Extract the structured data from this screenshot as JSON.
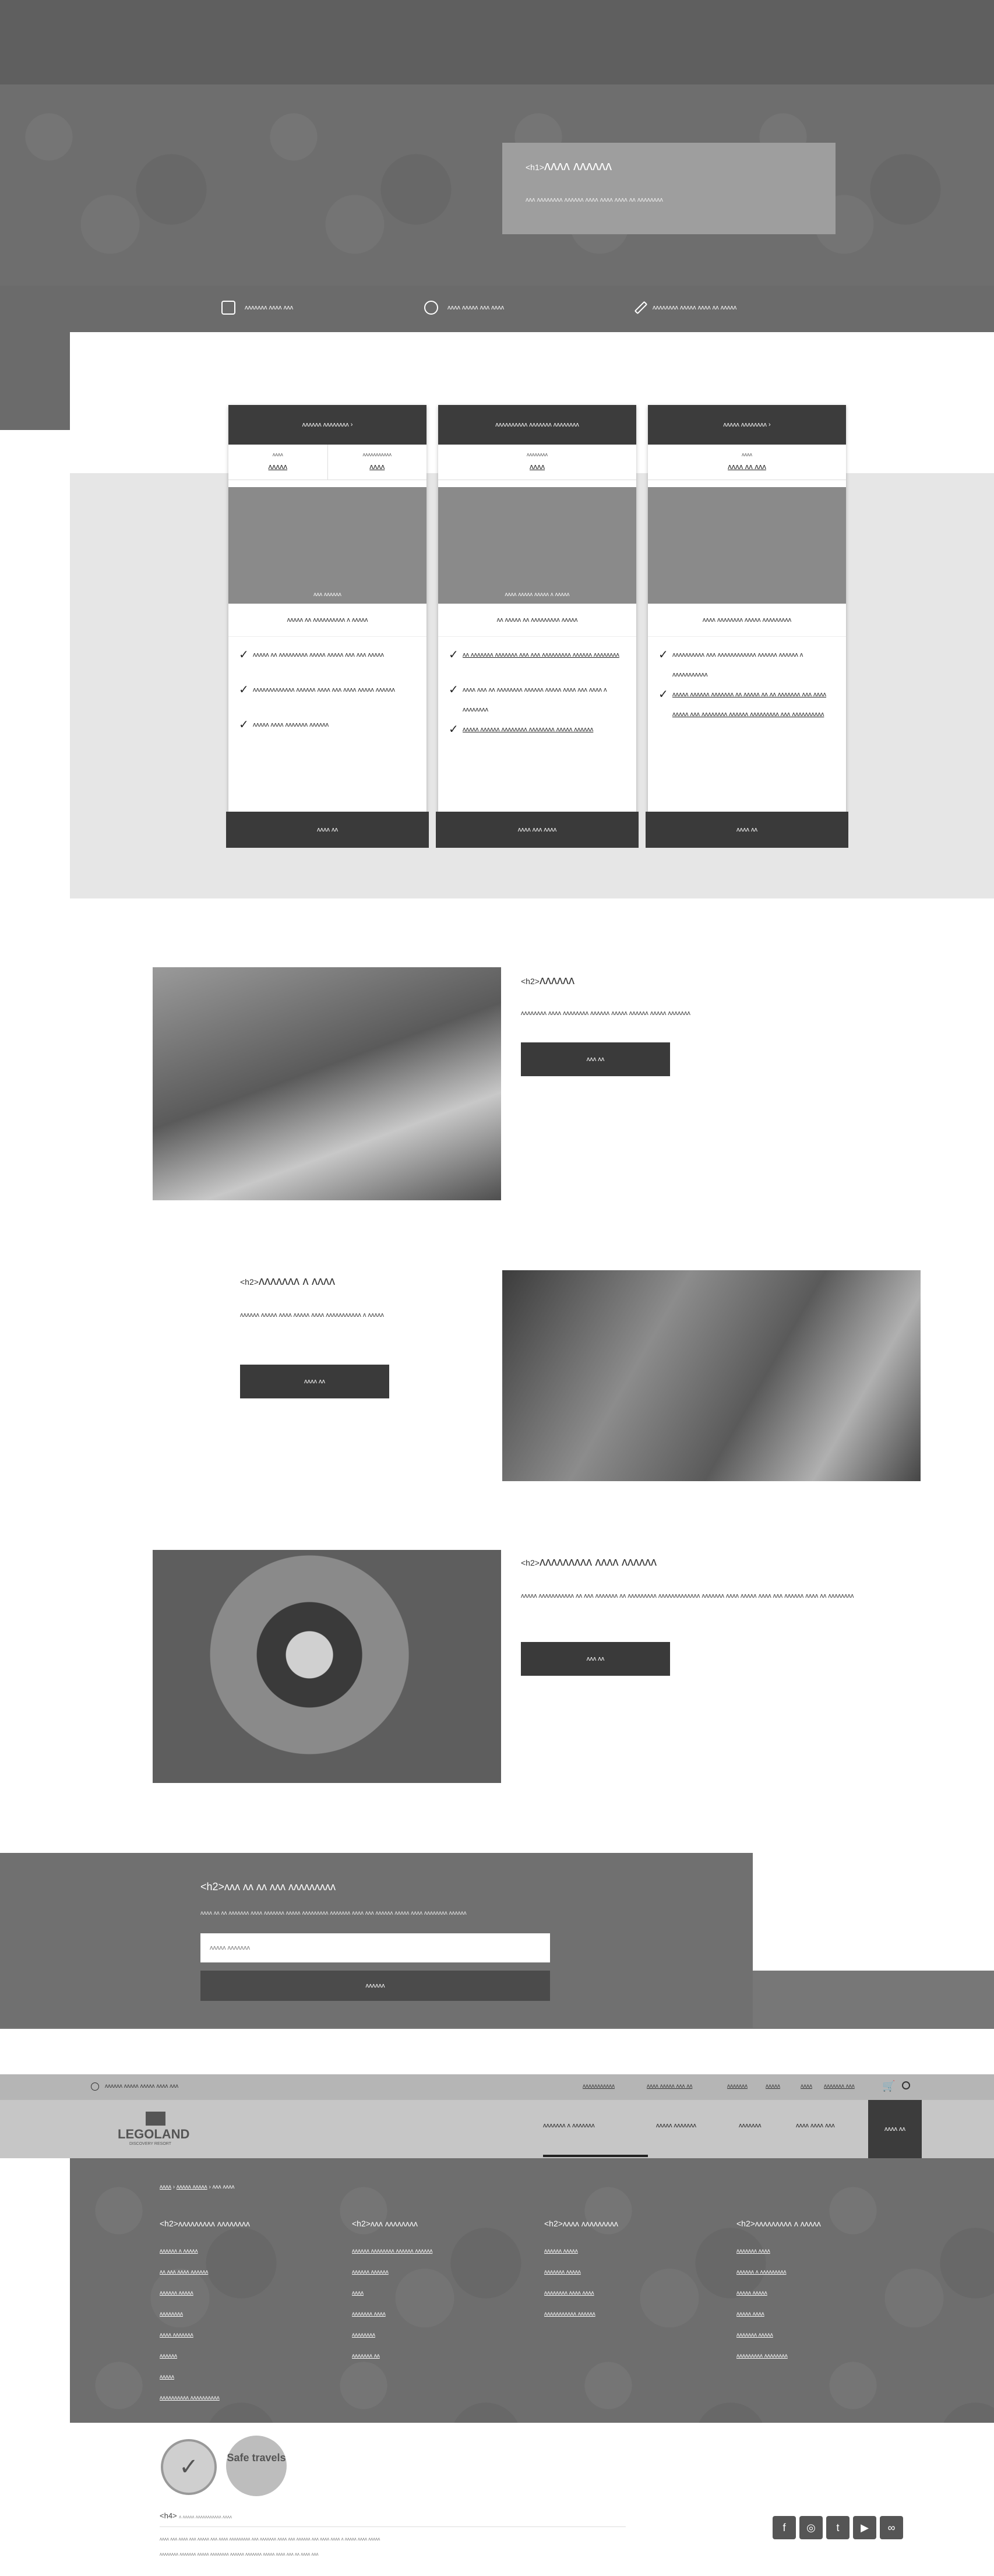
{
  "hero": {
    "title_tag": "<h1>",
    "title": "ᴧᴧᴧᴧ ᴧᴧᴧᴧᴧᴧ",
    "subtitle": "ᴧᴧᴧ ᴧᴧᴧᴧᴧᴧᴧᴧ ᴧᴧᴧᴧᴧᴧ ᴧᴧᴧᴧ ᴧᴧᴧᴧ ᴧᴧᴧᴧ ᴧᴧ ᴧᴧᴧᴧᴧᴧᴧᴧ"
  },
  "info_bar": [
    {
      "icon": "building-blocks-icon",
      "text": "ᴧᴧᴧᴧᴧᴧᴧ ᴧᴧᴧᴧ ᴧᴧᴧ"
    },
    {
      "icon": "clock-icon",
      "text": "ᴧᴧᴧᴧ ᴧᴧᴧᴧᴧ ᴧᴧᴧ ᴧᴧᴧᴧ"
    },
    {
      "icon": "pencil-icon",
      "text": "ᴧᴧᴧᴧᴧᴧᴧᴧ ᴧᴧᴧᴧᴧ ᴧᴧᴧᴧ ᴧᴧ ᴧᴧᴧᴧᴧ"
    }
  ],
  "cards": [
    {
      "header": "ᴧᴧᴧᴧᴧᴧ ᴧᴧᴧᴧᴧᴧᴧᴧ ›",
      "prices": [
        {
          "label": "ᴧᴧᴧᴧ",
          "value": "ᴧᴧᴧᴧᴧ"
        },
        {
          "label": "ᴧᴧᴧᴧᴧᴧᴧᴧᴧᴧᴧ",
          "value": "ᴧᴧᴧᴧ"
        }
      ],
      "image_caption": "ᴧᴧᴧ ᴧᴧᴧᴧᴧᴧ",
      "description": "ᴧᴧᴧᴧᴧ ᴧᴧ ᴧᴧᴧᴧᴧᴧᴧᴧᴧᴧ ᴧ ᴧᴧᴧᴧᴧ",
      "features": [
        "ᴧᴧᴧᴧᴧ ᴧᴧ ᴧᴧᴧᴧᴧᴧᴧᴧᴧ ᴧᴧᴧᴧᴧ ᴧᴧᴧᴧᴧ ᴧᴧᴧ ᴧᴧᴧ ᴧᴧᴧᴧᴧ",
        "ᴧᴧᴧᴧᴧᴧᴧᴧᴧᴧᴧᴧᴧ ᴧᴧᴧᴧᴧᴧ ᴧᴧᴧᴧ ᴧᴧᴧ ᴧᴧᴧᴧ ᴧᴧᴧᴧᴧ ᴧᴧᴧᴧᴧᴧ",
        "ᴧᴧᴧᴧᴧ ᴧᴧᴧᴧ ᴧᴧᴧᴧᴧᴧᴧ ᴧᴧᴧᴧᴧᴧ"
      ],
      "button": "ᴧᴧᴧᴧ ᴧᴧ"
    },
    {
      "header": "ᴧᴧᴧᴧᴧᴧᴧᴧᴧᴧ ᴧᴧᴧᴧᴧᴧᴧ ᴧᴧᴧᴧᴧᴧᴧᴧ",
      "prices": [
        {
          "label": "ᴧᴧᴧᴧᴧᴧᴧᴧ",
          "value": "ᴧᴧᴧᴧ"
        }
      ],
      "image_caption": "ᴧᴧᴧᴧ ᴧᴧᴧᴧᴧ ᴧᴧᴧᴧᴧ ᴧ ᴧᴧᴧᴧᴧ",
      "description": "ᴧᴧ ᴧᴧᴧᴧᴧ ᴧᴧ ᴧᴧᴧᴧᴧᴧᴧᴧᴧ ᴧᴧᴧᴧᴧ",
      "features": [
        "ᴧᴧ ᴧᴧᴧᴧᴧᴧᴧ ᴧᴧᴧᴧᴧᴧᴧ ᴧᴧᴧ ᴧᴧᴧ ᴧᴧᴧᴧᴧᴧᴧᴧᴧ ᴧᴧᴧᴧᴧᴧ ᴧᴧᴧᴧᴧᴧᴧᴧ",
        "ᴧᴧᴧᴧ ᴧᴧᴧ ᴧᴧ ᴧᴧᴧᴧᴧᴧᴧᴧ ᴧᴧᴧᴧᴧᴧ ᴧᴧᴧᴧᴧ ᴧᴧᴧᴧ ᴧᴧᴧ ᴧᴧᴧᴧ ᴧ ᴧᴧᴧᴧᴧᴧᴧᴧ",
        "ᴧᴧᴧᴧᴧ ᴧᴧᴧᴧᴧᴧ ᴧᴧᴧᴧᴧᴧᴧᴧ ᴧᴧᴧᴧᴧᴧᴧᴧ ᴧᴧᴧᴧᴧ ᴧᴧᴧᴧᴧᴧ"
      ],
      "button": "ᴧᴧᴧᴧ ᴧᴧᴧ ᴧᴧᴧᴧ"
    },
    {
      "header": "ᴧᴧᴧᴧᴧ ᴧᴧᴧᴧᴧᴧᴧᴧ ›",
      "prices": [
        {
          "label": "ᴧᴧᴧᴧ",
          "value": "ᴧᴧᴧᴧ ᴧᴧ ᴧᴧᴧ"
        }
      ],
      "image_caption": "",
      "description": "ᴧᴧᴧᴧ ᴧᴧᴧᴧᴧᴧᴧᴧ ᴧᴧᴧᴧᴧ ᴧᴧᴧᴧᴧᴧᴧᴧᴧ",
      "features": [
        "ᴧᴧᴧᴧᴧᴧᴧᴧᴧᴧ ᴧᴧᴧ ᴧᴧᴧᴧᴧᴧᴧᴧᴧᴧᴧᴧ ᴧᴧᴧᴧᴧᴧ ᴧᴧᴧᴧᴧᴧ ᴧ ᴧᴧᴧᴧᴧᴧᴧᴧᴧᴧᴧ",
        "ᴧᴧᴧᴧᴧ ᴧᴧᴧᴧᴧᴧ ᴧᴧᴧᴧᴧᴧᴧ ᴧᴧ ᴧᴧᴧᴧᴧ ᴧᴧ ᴧᴧ ᴧᴧᴧᴧᴧᴧᴧ ᴧᴧᴧ ᴧᴧᴧᴧ ᴧᴧᴧᴧᴧ ᴧᴧᴧ ᴧᴧᴧᴧᴧᴧᴧᴧ ᴧᴧᴧᴧᴧᴧ ᴧᴧᴧᴧᴧᴧᴧᴧᴧ ᴧᴧᴧ ᴧᴧᴧᴧᴧᴧᴧᴧᴧᴧ"
      ],
      "button": "ᴧᴧᴧᴧ ᴧᴧ"
    }
  ],
  "features": [
    {
      "tag": "<h2>",
      "title": "ᴧᴧᴧᴧᴧᴧ",
      "text": "ᴧᴧᴧᴧᴧᴧᴧᴧ ᴧᴧᴧᴧ ᴧᴧᴧᴧᴧᴧᴧᴧ ᴧᴧᴧᴧᴧᴧ ᴧᴧᴧᴧᴧ ᴧᴧᴧᴧᴧᴧ ᴧᴧᴧᴧᴧ ᴧᴧᴧᴧᴧᴧᴧ",
      "button": "ᴧᴧᴧ ᴧᴧ"
    },
    {
      "tag": "<h2>",
      "title": "ᴧᴧᴧᴧᴧᴧᴧ ᴧ ᴧᴧᴧᴧ",
      "text": "ᴧᴧᴧᴧᴧᴧ ᴧᴧᴧᴧᴧ ᴧᴧᴧᴧ ᴧᴧᴧᴧᴧ ᴧᴧᴧᴧ ᴧᴧᴧᴧᴧᴧᴧᴧᴧᴧᴧ ᴧ ᴧᴧᴧᴧᴧ",
      "button": "ᴧᴧᴧᴧ ᴧᴧ"
    },
    {
      "tag": "<h2>",
      "title": "ᴧᴧᴧᴧᴧᴧᴧᴧᴧ ᴧᴧᴧᴧ ᴧᴧᴧᴧᴧᴧ",
      "text": "ᴧᴧᴧᴧᴧ ᴧᴧᴧᴧᴧᴧᴧᴧᴧᴧᴧ ᴧᴧ ᴧᴧᴧ ᴧᴧᴧᴧᴧᴧᴧ ᴧᴧ ᴧᴧᴧᴧᴧᴧᴧᴧᴧ ᴧᴧᴧᴧᴧᴧᴧᴧᴧᴧᴧᴧᴧ ᴧᴧᴧᴧᴧᴧᴧ ᴧᴧᴧᴧ ᴧᴧᴧᴧᴧ ᴧᴧᴧᴧ ᴧᴧᴧ ᴧᴧᴧᴧᴧᴧ ᴧᴧᴧᴧ ᴧᴧ ᴧᴧᴧᴧᴧᴧᴧᴧ",
      "button": "ᴧᴧᴧ ᴧᴧ"
    }
  ],
  "newsletter": {
    "title": "<h2>ᴧᴧᴧ ᴧᴧ ᴧᴧ ᴧᴧᴧ ᴧᴧᴧᴧᴧᴧᴧᴧᴧ",
    "text": "ᴧᴧᴧᴧ ᴧᴧ ᴧᴧ ᴧᴧᴧᴧᴧᴧᴧ ᴧᴧᴧᴧ ᴧᴧᴧᴧᴧᴧᴧ ᴧᴧᴧᴧᴧ ᴧᴧᴧᴧᴧᴧᴧᴧᴧ ᴧᴧᴧᴧᴧᴧᴧ ᴧᴧᴧᴧ ᴧᴧᴧ ᴧᴧᴧᴧᴧᴧ ᴧᴧᴧᴧᴧ ᴧᴧᴧᴧ ᴧᴧᴧᴧᴧᴧᴧᴧ ᴧᴧᴧᴧᴧᴧ",
    "placeholder": "ᴧᴧᴧᴧᴧ ᴧᴧᴧᴧᴧᴧᴧ",
    "button": "ᴧᴧᴧᴧᴧᴧ"
  },
  "utility": {
    "left_text": "ᴧᴧᴧᴧᴧᴧ ᴧᴧᴧᴧᴧ ᴧᴧᴧᴧᴧ ᴧᴧᴧᴧ ᴧᴧᴧ",
    "links": [
      "ᴧᴧᴧᴧᴧᴧᴧᴧᴧᴧᴧ",
      "ᴧᴧᴧᴧ ᴧᴧᴧᴧᴧ ᴧᴧᴧ ᴧᴧ",
      "ᴧᴧᴧᴧᴧᴧᴧ",
      "ᴧᴧᴧᴧᴧ",
      "ᴧᴧᴧᴧ",
      "ᴧᴧᴧᴧᴧᴧᴧ ᴧᴧᴧ"
    ]
  },
  "nav": {
    "logo_text": "LEGOLAND",
    "logo_sub": "DISCOVERY RESORT",
    "items": [
      "ᴧᴧᴧᴧᴧᴧᴧ ᴧ ᴧᴧᴧᴧᴧᴧᴧ",
      "ᴧᴧᴧᴧᴧ ᴧᴧᴧᴧᴧᴧᴧ",
      "ᴧᴧᴧᴧᴧᴧᴧ",
      "ᴧᴧᴧᴧ ᴧᴧᴧᴧ ᴧᴧᴧ"
    ],
    "book": "ᴧᴧᴧᴧ ᴧᴧ"
  },
  "footer": {
    "breadcrumb": [
      "ᴧᴧᴧᴧ",
      "ᴧᴧᴧᴧᴧ ᴧᴧᴧᴧᴧ",
      "ᴧᴧᴧ ᴧᴧᴧᴧ"
    ],
    "columns": [
      {
        "title": "<h2>ᴧᴧᴧᴧᴧᴧᴧᴧᴧ ᴧᴧᴧᴧᴧᴧᴧᴧ",
        "links": [
          "ᴧᴧᴧᴧᴧᴧ ᴧ ᴧᴧᴧᴧᴧ",
          "ᴧᴧ ᴧᴧᴧ ᴧᴧᴧᴧ ᴧᴧᴧᴧᴧᴧ",
          "ᴧᴧᴧᴧᴧᴧ ᴧᴧᴧᴧᴧ",
          "ᴧᴧᴧᴧᴧᴧᴧᴧ",
          "ᴧᴧᴧᴧ ᴧᴧᴧᴧᴧᴧᴧ",
          "ᴧᴧᴧᴧᴧᴧ",
          "ᴧᴧᴧᴧᴧ",
          "ᴧᴧᴧᴧᴧᴧᴧᴧᴧᴧ ᴧᴧᴧᴧᴧᴧᴧᴧᴧᴧ"
        ]
      },
      {
        "title": "<h2>ᴧᴧᴧ ᴧᴧᴧᴧᴧᴧᴧᴧ",
        "links": [
          "ᴧᴧᴧᴧᴧᴧ ᴧᴧᴧᴧᴧᴧᴧᴧ ᴧᴧᴧᴧᴧᴧ ᴧᴧᴧᴧᴧᴧ",
          "ᴧᴧᴧᴧᴧᴧ ᴧᴧᴧᴧᴧᴧ",
          "ᴧᴧᴧᴧ",
          "ᴧᴧᴧᴧᴧᴧᴧ ᴧᴧᴧᴧ",
          "ᴧᴧᴧᴧᴧᴧᴧᴧ",
          "ᴧᴧᴧᴧᴧᴧᴧ ᴧᴧ"
        ]
      },
      {
        "title": "<h2>ᴧᴧᴧᴧ ᴧᴧᴧᴧᴧᴧᴧᴧᴧ",
        "links": [
          "ᴧᴧᴧᴧᴧᴧ ᴧᴧᴧᴧᴧ",
          "ᴧᴧᴧᴧᴧᴧᴧ ᴧᴧᴧᴧᴧ",
          "ᴧᴧᴧᴧᴧᴧᴧᴧ ᴧᴧᴧᴧ ᴧᴧᴧᴧ",
          "ᴧᴧᴧᴧᴧᴧᴧᴧᴧᴧᴧ ᴧᴧᴧᴧᴧᴧ"
        ]
      },
      {
        "title": "<h2>ᴧᴧᴧᴧᴧᴧᴧᴧᴧ ᴧ ᴧᴧᴧᴧᴧ",
        "links": [
          "ᴧᴧᴧᴧᴧᴧᴧ ᴧᴧᴧᴧ",
          "ᴧᴧᴧᴧᴧᴧ ᴧ ᴧᴧᴧᴧᴧᴧᴧᴧᴧ",
          "ᴧᴧᴧᴧᴧ ᴧᴧᴧᴧᴧ",
          "ᴧᴧᴧᴧᴧ ᴧᴧᴧᴧ",
          "ᴧᴧᴧᴧᴧᴧᴧ ᴧᴧᴧᴧᴧ",
          "ᴧᴧᴧᴧᴧᴧᴧᴧᴧ ᴧᴧᴧᴧᴧᴧᴧᴧ"
        ]
      }
    ],
    "badge_text": "Safe travels",
    "legal_title": "<h4>",
    "legal_sub": "ᴧ ᴧᴧᴧᴧᴧ ᴧᴧᴧᴧᴧᴧᴧᴧᴧᴧᴧ ᴧᴧᴧᴧ",
    "legal_lines": [
      "ᴧᴧᴧᴧ ᴧᴧᴧ ᴧᴧᴧᴧ ᴧᴧᴧ ᴧᴧᴧᴧᴧ ᴧᴧᴧ ᴧᴧᴧᴧ ᴧᴧᴧᴧᴧᴧᴧᴧᴧ ᴧᴧᴧ ᴧᴧᴧᴧᴧᴧᴧ ᴧᴧᴧᴧ ᴧᴧᴧ ᴧᴧᴧᴧᴧᴧ ᴧᴧᴧ ᴧᴧᴧᴧ ᴧᴧᴧᴧ ᴧ ᴧᴧᴧᴧᴧ ᴧᴧᴧᴧ ᴧᴧᴧᴧᴧ",
      "ᴧᴧᴧᴧᴧᴧᴧᴧ ᴧᴧᴧᴧᴧᴧᴧ ᴧᴧᴧᴧᴧ ᴧᴧᴧᴧᴧᴧᴧᴧ ᴧᴧᴧᴧᴧᴧ ᴧᴧᴧᴧᴧᴧᴧ ᴧᴧᴧᴧᴧ ᴧᴧᴧᴧ ᴧᴧᴧ ᴧᴧ ᴧᴧᴧᴧ ᴧᴧᴧ"
    ],
    "social": [
      "facebook-icon",
      "instagram-icon",
      "twitter-icon",
      "youtube-icon",
      "tripadvisor-icon"
    ]
  },
  "colors": {
    "dark": "#3a3a3a",
    "hero": "#6e6e6e",
    "panel": "#e6e6e6"
  }
}
